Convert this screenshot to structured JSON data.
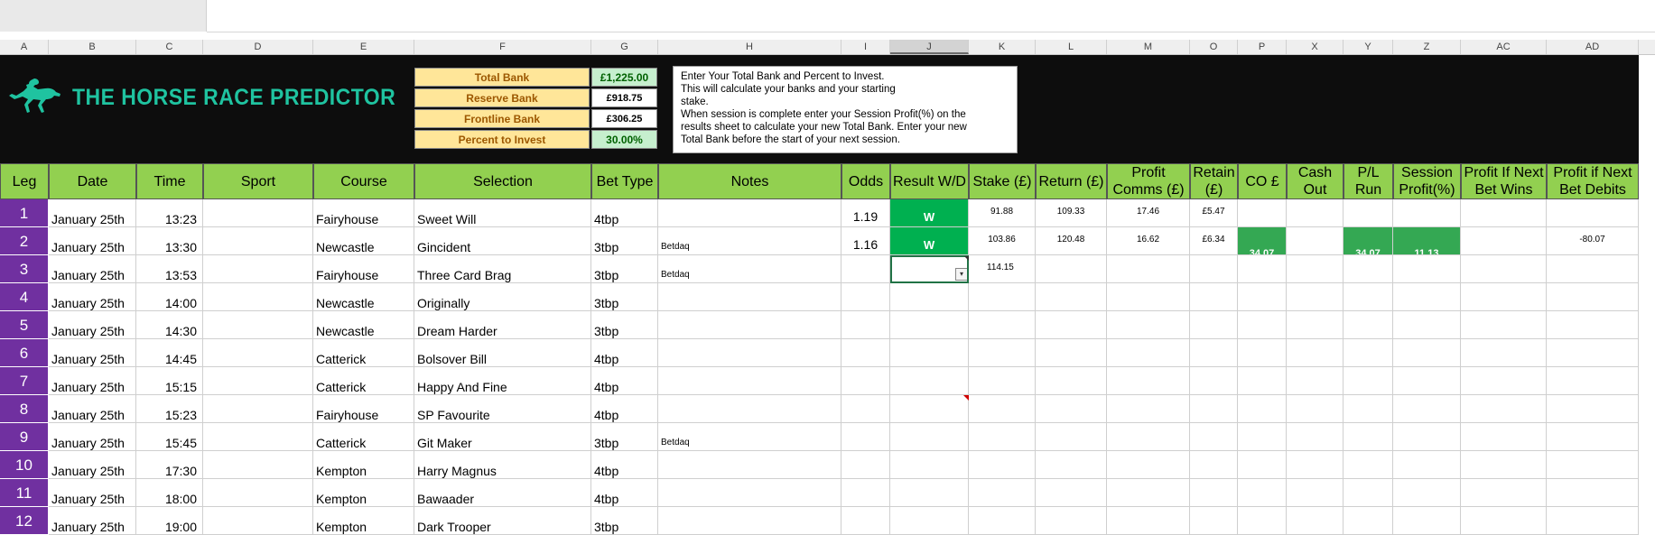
{
  "header": {
    "app_name": "THE HORSE RACE PREDICTOR",
    "colors": {
      "banner": "#0d0d0d",
      "logo": "#1fc3a0",
      "header_fill": "#92d050",
      "leg_fill": "#7030a0",
      "win_fill": "#00b050",
      "highlight_fill": "#34a853"
    }
  },
  "column_letters": [
    "A",
    "B",
    "C",
    "D",
    "E",
    "F",
    "G",
    "H",
    "I",
    "J",
    "K",
    "L",
    "M",
    "O",
    "P",
    "X",
    "Y",
    "Z",
    "AC",
    "AD"
  ],
  "bank": {
    "total_label": "Total Bank",
    "total_value": "£1,225.00",
    "reserve_label": "Reserve Bank",
    "reserve_value": "£918.75",
    "frontline_label": "Frontline Bank",
    "frontline_value": "£306.25",
    "percent_label": "Percent to Invest",
    "percent_value": "30.00%"
  },
  "instructions": {
    "line1": "Enter Your Total Bank and Percent to Invest.",
    "line2": "This will calculate your banks and your starting",
    "line3": "stake.",
    "line4": "When session is complete enter your Session Profit(%) on the",
    "line5": "results sheet to calculate your new Total Bank. Enter your new",
    "line6": "Total Bank before the start of your next session."
  },
  "table": {
    "headers": [
      "Leg",
      "Date",
      "Time",
      "Sport",
      "Course",
      "Selection",
      "Bet Type",
      "Notes",
      "Odds",
      "Result W/D",
      "Stake (£)",
      "Return (£)",
      "Profit Comms (£)",
      "Retain (£)",
      "CO £",
      "Cash Out",
      "P/L Run",
      "Session Profit(%)",
      "Profit If Next Bet Wins",
      "Profit if Next Bet Debits"
    ],
    "headers_split": {
      "profit_a": "Profit",
      "profit_b": "Comms (£)",
      "retain_a": "Retain",
      "retain_b": "(£)",
      "cash_a": "Cash",
      "cash_b": "Out",
      "pl_a": "P/L",
      "pl_b": "Run",
      "session_a": "Session",
      "session_b": "Profit(%)",
      "wins_a": "Profit If Next",
      "wins_b": "Bet Wins",
      "debits_a": "Profit if Next",
      "debits_b": "Bet Debits"
    },
    "rows": [
      {
        "leg": "1",
        "date": "January 25th",
        "time": "13:23",
        "sport": "",
        "course": "Fairyhouse",
        "selection": "Sweet Will",
        "bet_type": "4tbp",
        "notes": "",
        "odds": "1.19",
        "result": "W",
        "stake": "91.88",
        "return": "109.33",
        "profit": "17.46",
        "retain": "£5.47",
        "co": "",
        "cash_out": "",
        "pl_run": "",
        "session": "",
        "wins": "",
        "debits": ""
      },
      {
        "leg": "2",
        "date": "January 25th",
        "time": "13:30",
        "sport": "",
        "course": "Newcastle",
        "selection": "Gincident",
        "bet_type": "3tbp",
        "notes": "Betdaq",
        "odds": "1.16",
        "result": "W",
        "stake": "103.86",
        "return": "120.48",
        "profit": "16.62",
        "retain": "£6.34",
        "co": "34.07",
        "cash_out": "",
        "pl_run": "34.07",
        "session": "11.13",
        "wins": "",
        "debits": "-80.07"
      },
      {
        "leg": "3",
        "date": "January 25th",
        "time": "13:53",
        "sport": "",
        "course": "Fairyhouse",
        "selection": "Three Card Brag",
        "bet_type": "3tbp",
        "notes": "Betdaq",
        "odds": "",
        "result": "",
        "stake": "114.15",
        "return": "",
        "profit": "",
        "retain": "",
        "co": "",
        "cash_out": "",
        "pl_run": "",
        "session": "",
        "wins": "",
        "debits": ""
      },
      {
        "leg": "4",
        "date": "January 25th",
        "time": "14:00",
        "sport": "",
        "course": "Newcastle",
        "selection": "Originally",
        "bet_type": "3tbp",
        "notes": ""
      },
      {
        "leg": "5",
        "date": "January 25th",
        "time": "14:30",
        "sport": "",
        "course": "Newcastle",
        "selection": "Dream Harder",
        "bet_type": "3tbp",
        "notes": ""
      },
      {
        "leg": "6",
        "date": "January 25th",
        "time": "14:45",
        "sport": "",
        "course": "Catterick",
        "selection": "Bolsover Bill",
        "bet_type": "4tbp",
        "notes": ""
      },
      {
        "leg": "7",
        "date": "January 25th",
        "time": "15:15",
        "sport": "",
        "course": "Catterick",
        "selection": "Happy And Fine",
        "bet_type": "4tbp",
        "notes": ""
      },
      {
        "leg": "8",
        "date": "January 25th",
        "time": "15:23",
        "sport": "",
        "course": "Fairyhouse",
        "selection": "SP Favourite",
        "bet_type": "4tbp",
        "notes": ""
      },
      {
        "leg": "9",
        "date": "January 25th",
        "time": "15:45",
        "sport": "",
        "course": "Catterick",
        "selection": "Git Maker",
        "bet_type": "3tbp",
        "notes": "Betdaq"
      },
      {
        "leg": "10",
        "date": "January 25th",
        "time": "17:30",
        "sport": "",
        "course": "Kempton",
        "selection": "Harry Magnus",
        "bet_type": "4tbp",
        "notes": ""
      },
      {
        "leg": "11",
        "date": "January 25th",
        "time": "18:00",
        "sport": "",
        "course": "Kempton",
        "selection": "Bawaader",
        "bet_type": "4tbp",
        "notes": ""
      },
      {
        "leg": "12",
        "date": "January 25th",
        "time": "19:00",
        "sport": "",
        "course": "Kempton",
        "selection": "Dark Trooper",
        "bet_type": "3tbp",
        "notes": ""
      }
    ]
  }
}
